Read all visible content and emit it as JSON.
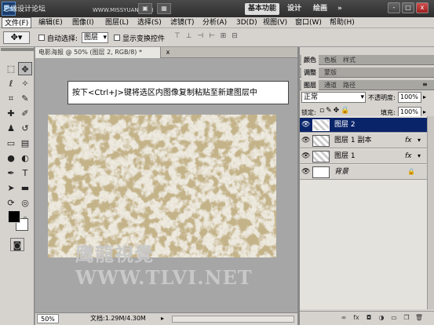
{
  "titlebar": {
    "app_logo": "Ps",
    "watermark": "思缘设计论坛",
    "watermark_url": "WWW.MISSYUAN.COM",
    "workspaces": [
      "基本功能",
      "设计",
      "绘画"
    ],
    "more": "»",
    "window_buttons": [
      "-",
      "□",
      "x"
    ]
  },
  "menubar": {
    "items": [
      "文件(F)",
      "编辑(E)",
      "图像(I)",
      "图层(L)",
      "选择(S)",
      "滤镜(T)",
      "分析(A)",
      "3D(D)",
      "视图(V)",
      "窗口(W)",
      "帮助(H)"
    ]
  },
  "options": {
    "auto_select_label": "自动选择:",
    "auto_select_value": "图层",
    "show_transform_label": "显示变换控件"
  },
  "document": {
    "title": "电影海报 @ 50% (图层 2, RGB/8) *",
    "close": "x",
    "callout": "按下<Ctrl+J>键将选区内图像复制粘贴至新建图层中",
    "site_watermark": "鹰龍視覺 WWW.TLVI.NET",
    "zoom": "50%",
    "doc_info": "文档:1.29M/4.30M"
  },
  "panels": {
    "group1_tabs": [
      "颜色",
      "色板",
      "样式"
    ],
    "group2_tabs": [
      "调整",
      "蒙版"
    ],
    "layers_tabs": [
      "图层",
      "通道",
      "路径"
    ],
    "blend_mode": "正常",
    "opacity_label": "不透明度:",
    "opacity_value": "100%",
    "lock_label": "锁定:",
    "fill_label": "填充:",
    "fill_value": "100%",
    "layers": [
      {
        "name": "图层 2",
        "fx": "",
        "selected": true
      },
      {
        "name": "图层 1 副本",
        "fx": "fx",
        "selected": false
      },
      {
        "name": "图层 1",
        "fx": "fx",
        "selected": false
      },
      {
        "name": "背景",
        "fx": "",
        "selected": false
      }
    ]
  },
  "colors": {
    "selection": "#0a246a",
    "foreground": "#000000",
    "background": "#ffffff"
  }
}
